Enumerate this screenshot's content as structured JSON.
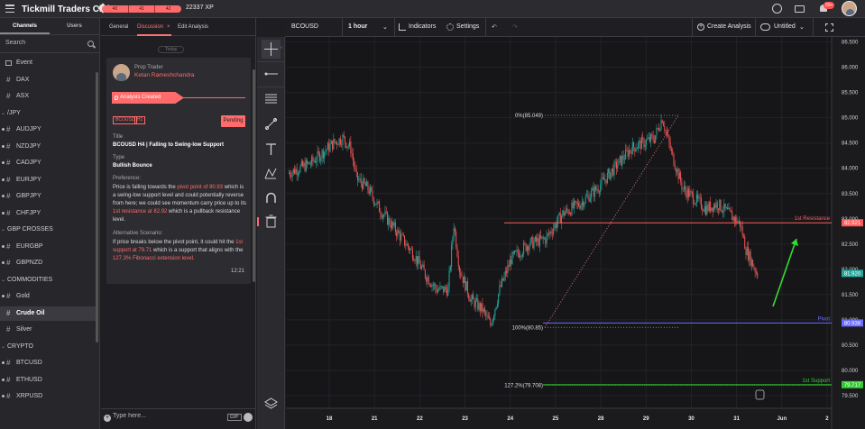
{
  "topbar": {
    "title": "Tickmill Traders Club",
    "xp_segments": [
      "40",
      "41",
      "42"
    ],
    "xp_value": "22337 XP",
    "notification_count": "99+"
  },
  "leftnav": {
    "tabs": [
      "Channels",
      "Users"
    ],
    "search_placeholder": "Search",
    "rows": [
      {
        "kind": "event",
        "label": "Event"
      },
      {
        "kind": "item",
        "label": "DAX"
      },
      {
        "kind": "item",
        "label": "ASX"
      },
      {
        "kind": "group",
        "label": "/JPY"
      },
      {
        "kind": "item",
        "label": "AUDJPY",
        "dot": true
      },
      {
        "kind": "item",
        "label": "NZDJPY",
        "dot": true
      },
      {
        "kind": "item",
        "label": "CADJPY",
        "dot": true
      },
      {
        "kind": "item",
        "label": "EURJPY",
        "dot": true
      },
      {
        "kind": "item",
        "label": "GBPJPY",
        "dot": true
      },
      {
        "kind": "item",
        "label": "CHFJPY",
        "dot": true
      },
      {
        "kind": "group",
        "label": "GBP CROSSES"
      },
      {
        "kind": "item",
        "label": "EURGBP",
        "dot": true
      },
      {
        "kind": "item",
        "label": "GBPNZD",
        "dot": true
      },
      {
        "kind": "group",
        "label": "COMMODITIES"
      },
      {
        "kind": "item",
        "label": "Gold",
        "dot": true
      },
      {
        "kind": "item",
        "label": "Crude Oil",
        "active": true
      },
      {
        "kind": "item",
        "label": "Silver"
      },
      {
        "kind": "group",
        "label": "CRYPTO"
      },
      {
        "kind": "item",
        "label": "BTCUSD",
        "dot": true
      },
      {
        "kind": "item",
        "label": "ETHUSD",
        "dot": true
      },
      {
        "kind": "item",
        "label": "XRPUSD",
        "dot": true
      }
    ]
  },
  "discussion": {
    "tabs": [
      "General",
      "Discussion",
      "Edit Analysis"
    ],
    "close_glyph": "×",
    "date_pill": "Today",
    "author_role": "Prop Trader",
    "author_name": "Ketan Rameshchandra",
    "ribbon_label": "Analysis Created",
    "tags": [
      "BCOUSD",
      "H1"
    ],
    "status": "Pending",
    "title_label": "Title",
    "title_value": "BCOUSD H4 | Falling to Swing-low Support",
    "type_label": "Type",
    "type_value": "Bullish Bounce",
    "preference_label": "Preference:",
    "preference_parts": [
      {
        "t": "Price is falling towards the "
      },
      {
        "t": "pivot point of 80.93",
        "hl": true
      },
      {
        "t": " which is a swing-low support level and could potentially reverse from here; we could see momentum carry price up to its "
      },
      {
        "t": "1st resistance at 82.92",
        "hl": true
      },
      {
        "t": " which is a pullback resistance level."
      }
    ],
    "alt_label": "Alternative Scenario:",
    "alt_parts": [
      {
        "t": "If price breaks below the pivot point, it could hit the "
      },
      {
        "t": "1st support at 79.71",
        "hl": true
      },
      {
        "t": " which is a support that aligns with the "
      },
      {
        "t": "127.3% Fibonacci extension level.",
        "hl": true
      }
    ],
    "time": "12:21",
    "composer_placeholder": "Type here...",
    "gif_label": "GIF"
  },
  "toolbar": {
    "tools": [
      "crosshair-icon",
      "horizontal-line-icon",
      "fib-levels-icon",
      "trend-line-icon",
      "text-tool-icon",
      "pattern-icon",
      "magnet-icon",
      "trash-icon",
      "layers-icon"
    ]
  },
  "chartbar": {
    "symbol": "BCOUSD",
    "interval": "1 hour",
    "indicators_label": "Indicators",
    "settings_label": "Settings",
    "create_label": "Create Analysis",
    "untitled_label": "Untitled"
  },
  "chart_data": {
    "type": "candlestick",
    "symbol": "BCOUSD",
    "interval": "1 hour",
    "ylim": [
      79.25,
      86.6
    ],
    "y_ticks": [
      79.5,
      80.0,
      80.5,
      81.0,
      81.5,
      82.0,
      82.5,
      83.0,
      83.5,
      84.0,
      84.5,
      85.0,
      85.5,
      86.0,
      86.5
    ],
    "x_ticks": [
      "18",
      "21",
      "22",
      "23",
      "24",
      "25",
      "28",
      "29",
      "30",
      "31",
      "Jun",
      "2"
    ],
    "levels": [
      {
        "name": "1st Resistance",
        "value": 82.921,
        "value_label": "82.921",
        "color": "#ff5a5a"
      },
      {
        "name": "Pivot",
        "value": 80.938,
        "value_label": "80.938",
        "color": "#6b6bff"
      },
      {
        "name": "1st Support",
        "value": 79.717,
        "value_label": "79.717",
        "color": "#33cc33"
      }
    ],
    "current_price": 81.92,
    "current_price_label": "81.920",
    "fib_labels": [
      {
        "text": "0%(85.049)",
        "value": 85.049
      },
      {
        "text": "100%(80.85)",
        "value": 80.85
      },
      {
        "text": "127.2%(79.708)",
        "value": 79.708
      }
    ],
    "close_path": [
      {
        "i": 0,
        "v": 83.9
      },
      {
        "i": 10,
        "v": 84.0
      },
      {
        "i": 20,
        "v": 84.1
      },
      {
        "i": 30,
        "v": 84.3
      },
      {
        "i": 40,
        "v": 84.5
      },
      {
        "i": 48,
        "v": 84.6
      },
      {
        "i": 55,
        "v": 84.4
      },
      {
        "i": 60,
        "v": 83.8
      },
      {
        "i": 70,
        "v": 83.6
      },
      {
        "i": 80,
        "v": 83.2
      },
      {
        "i": 90,
        "v": 82.9
      },
      {
        "i": 100,
        "v": 82.6
      },
      {
        "i": 110,
        "v": 82.3
      },
      {
        "i": 120,
        "v": 81.9
      },
      {
        "i": 130,
        "v": 81.6
      },
      {
        "i": 140,
        "v": 81.6
      },
      {
        "i": 145,
        "v": 82.9
      },
      {
        "i": 150,
        "v": 82.0
      },
      {
        "i": 160,
        "v": 81.4
      },
      {
        "i": 170,
        "v": 81.2
      },
      {
        "i": 177,
        "v": 80.9
      },
      {
        "i": 185,
        "v": 81.6
      },
      {
        "i": 195,
        "v": 82.2
      },
      {
        "i": 210,
        "v": 82.5
      },
      {
        "i": 225,
        "v": 82.6
      },
      {
        "i": 240,
        "v": 83.1
      },
      {
        "i": 255,
        "v": 83.3
      },
      {
        "i": 270,
        "v": 83.6
      },
      {
        "i": 285,
        "v": 84.0
      },
      {
        "i": 300,
        "v": 84.4
      },
      {
        "i": 310,
        "v": 84.5
      },
      {
        "i": 320,
        "v": 84.6
      },
      {
        "i": 327,
        "v": 85.0
      },
      {
        "i": 335,
        "v": 84.3
      },
      {
        "i": 345,
        "v": 83.6
      },
      {
        "i": 355,
        "v": 83.4
      },
      {
        "i": 365,
        "v": 83.2
      },
      {
        "i": 375,
        "v": 83.3
      },
      {
        "i": 385,
        "v": 83.1
      },
      {
        "i": 395,
        "v": 82.9
      },
      {
        "i": 400,
        "v": 82.4
      },
      {
        "i": 410,
        "v": 81.9
      }
    ]
  }
}
